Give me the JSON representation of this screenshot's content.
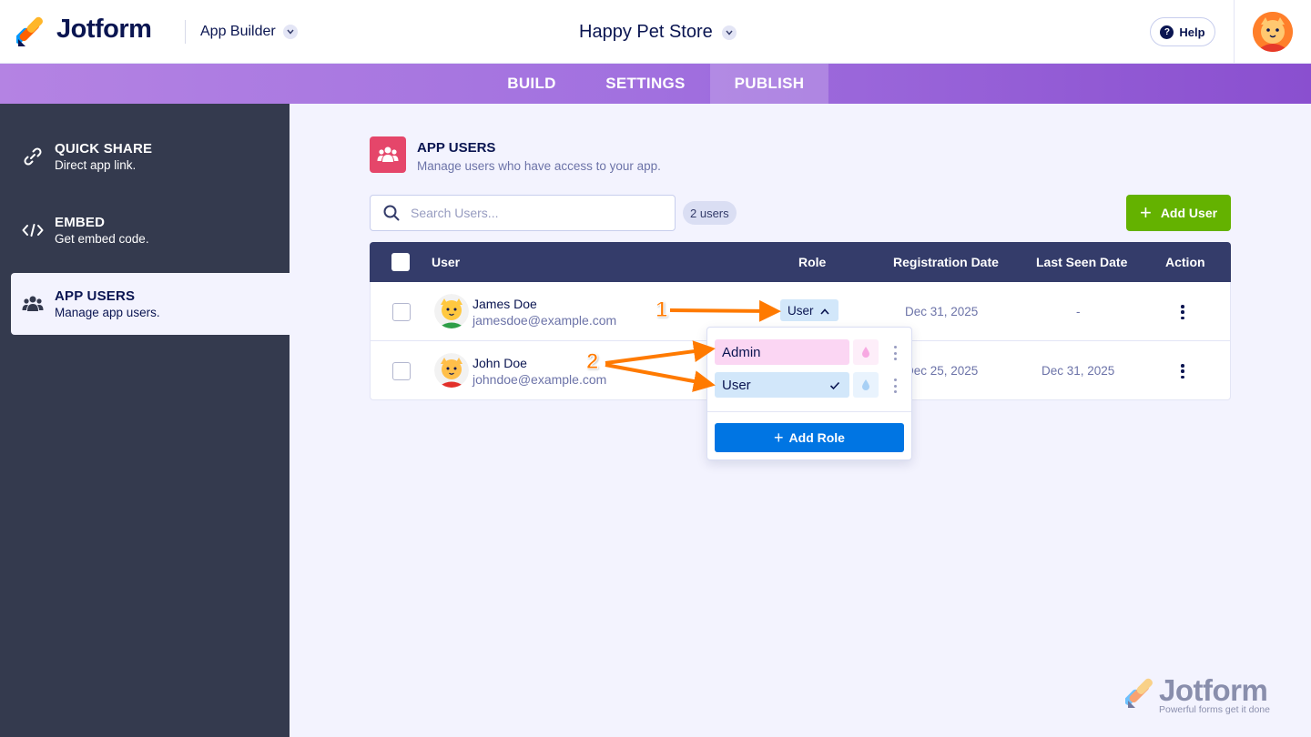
{
  "brand": {
    "name": "Jotform",
    "tagline": "Powerful forms get it done"
  },
  "header": {
    "app_builder_label": "App Builder",
    "app_title": "Happy Pet Store",
    "help_label": "Help"
  },
  "tabs": [
    {
      "label": "BUILD",
      "active": false
    },
    {
      "label": "SETTINGS",
      "active": false
    },
    {
      "label": "PUBLISH",
      "active": true
    }
  ],
  "sidebar": {
    "items": [
      {
        "title": "QUICK SHARE",
        "subtitle": "Direct app link.",
        "icon": "link-icon",
        "active": false
      },
      {
        "title": "EMBED",
        "subtitle": "Get embed code.",
        "icon": "code-icon",
        "active": false
      },
      {
        "title": "APP USERS",
        "subtitle": "Manage app users.",
        "icon": "users-icon",
        "active": true
      }
    ]
  },
  "section": {
    "title": "APP USERS",
    "subtitle": "Manage users who have access to your app.",
    "icon": "users-icon"
  },
  "search": {
    "placeholder": "Search Users...",
    "value": ""
  },
  "user_count": "2 users",
  "add_user_label": "Add User",
  "table": {
    "columns": [
      "User",
      "Role",
      "Registration Date",
      "Last Seen Date",
      "Action"
    ],
    "rows": [
      {
        "name": "James Doe",
        "email": "jamesdoe@example.com",
        "role": "User",
        "registration_date": "Dec 31, 2025",
        "last_seen": "-"
      },
      {
        "name": "John Doe",
        "email": "johndoe@example.com",
        "role": "User",
        "registration_date": "Dec 25, 2025",
        "last_seen": "Dec 31, 2025"
      }
    ]
  },
  "role_dropdown": {
    "options": [
      {
        "label": "Admin",
        "selected": false,
        "color": "#fbd6f3"
      },
      {
        "label": "User",
        "selected": true,
        "color": "#d2e7fa"
      }
    ],
    "add_role_label": "Add Role"
  },
  "annotations": {
    "step1": "1",
    "step2": "2",
    "color": "#ff7a00"
  },
  "colors": {
    "accent_purple": "#a170df",
    "sidebar_bg": "#343a4e",
    "table_header_bg": "#343c6a",
    "add_user_green": "#64b200",
    "add_role_blue": "#0075e3",
    "section_icon_pink": "#e5466a"
  }
}
